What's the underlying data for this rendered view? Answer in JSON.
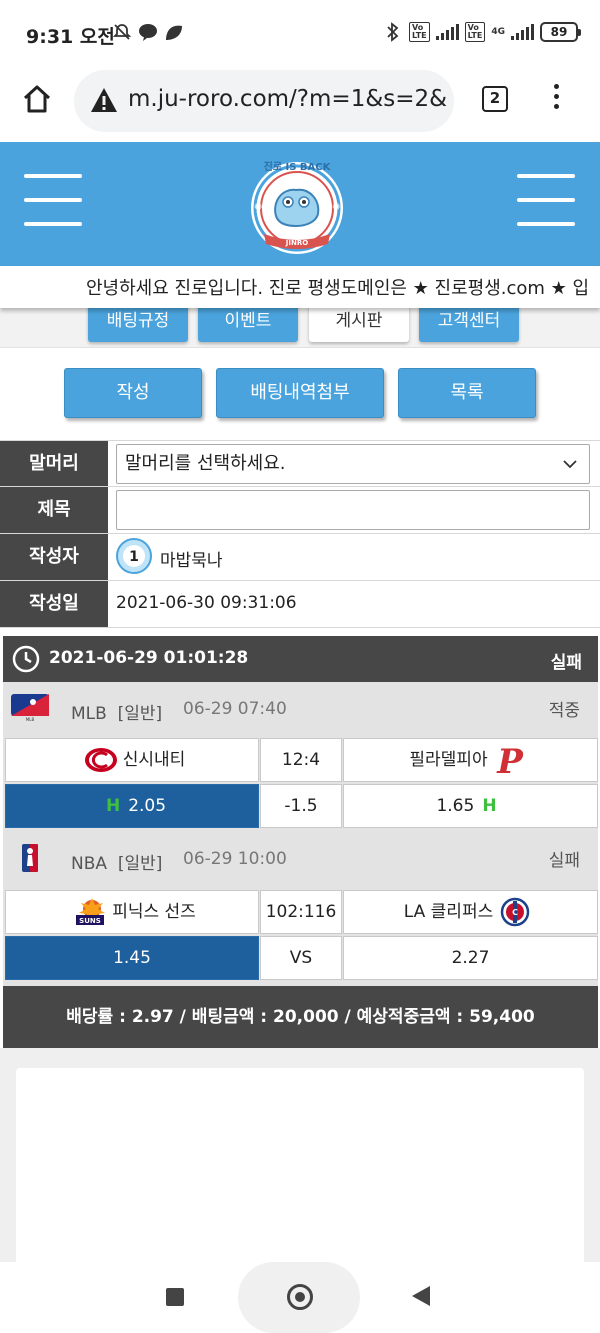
{
  "status_bar": {
    "time": "9:31 오전",
    "battery": "89",
    "network_4g": "4G"
  },
  "browser": {
    "url": "m.ju-roro.com/?m=1&s=2&x=",
    "tab_count": "2"
  },
  "header": {
    "logo_top": "진로 IS BACK",
    "logo_bottom": "JINRO"
  },
  "marquee": {
    "text": "안녕하세요 진로입니다. 진로 평생도메인은 ★ 진로평생.com ★ 입"
  },
  "nav_tabs": [
    "배팅규정",
    "이벤트",
    "게시판",
    "고객센터"
  ],
  "actions": {
    "write": "작성",
    "attach_bets": "배팅내역첨부",
    "list": "목록"
  },
  "form": {
    "prefix_label": "말머리",
    "prefix_value": "말머리를 선택하세요.",
    "title_label": "제목",
    "title_value": "",
    "author_label": "작성자",
    "author_level": "1",
    "author_name": "마밥묵나",
    "date_label": "작성일",
    "date_value": "2021-06-30 09:31:06"
  },
  "bet_slip": {
    "datetime": "2021-06-29 01:01:28",
    "result": "실패",
    "games": [
      {
        "league": "MLB",
        "type": "[일반]",
        "time": "06-29 07:40",
        "result": "적중",
        "home": "신시내티",
        "score": "12:4",
        "away": "필라델피아",
        "home_odds": "2.05",
        "line": "-1.5",
        "away_odds": "1.65",
        "home_mark": "H",
        "away_mark": "H",
        "selected": "home"
      },
      {
        "league": "NBA",
        "type": "[일반]",
        "time": "06-29 10:00",
        "result": "실패",
        "home": "피닉스 선즈",
        "score": "102:116",
        "away": "LA 클리퍼스",
        "home_odds": "1.45",
        "line": "VS",
        "away_odds": "2.27",
        "selected": "home"
      }
    ],
    "summary": "배당률 : 2.97 / 배팅금액 : 20,000 / 예상적중금액 : 59,400"
  },
  "colors": {
    "header_blue": "#4aa3dc",
    "dark_bar": "#474747",
    "selected_cell": "#1e5f9d",
    "handicap_green": "#3fbf3f"
  }
}
